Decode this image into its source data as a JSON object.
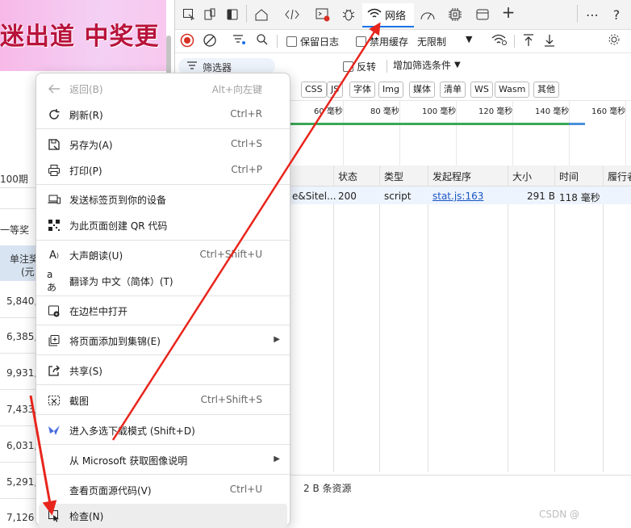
{
  "webpage": {
    "banner_text": "迷出道 中奖更",
    "period": "100期",
    "prize_label": "一等奖",
    "column_header_line1": "单注奖",
    "column_header_line2": "(元",
    "amounts": [
      "5,840,",
      "6,385,",
      "9,931,",
      "7,433,",
      "6,031,",
      "5,291,",
      "7,126"
    ]
  },
  "devtools": {
    "tabs": {
      "network_label": "网络"
    },
    "toolbar": {
      "preserve_log": "保留日志",
      "disable_cache": "禁用缓存",
      "throttle": "无限制"
    },
    "filter": {
      "placeholder": "筛选器",
      "invert": "反转",
      "more_filters": "增加筛选条件"
    },
    "type_chips": [
      "CSS",
      "JS",
      "字体",
      "Img",
      "媒体",
      "清单",
      "WS",
      "Wasm",
      "其他"
    ],
    "timeline_ticks": [
      "60 毫秒",
      "80 毫秒",
      "100 毫秒",
      "120 毫秒",
      "140 毫秒",
      "160 毫秒"
    ],
    "table": {
      "headers": [
        "状态",
        "类型",
        "发起程序",
        "大小",
        "时间",
        "履行者"
      ],
      "rows": [
        {
          "name": "e&Sitel...",
          "status": "200",
          "type": "script",
          "initiator": "stat.js:163",
          "size": "291 B",
          "time": "118 毫秒"
        }
      ]
    },
    "status_summary": "2 B 条资源"
  },
  "context_menu": {
    "items": [
      {
        "label": "返回(B)",
        "shortcut": "Alt+向左键",
        "icon": "back-arrow-icon",
        "disabled": true
      },
      {
        "label": "刷新(R)",
        "shortcut": "Ctrl+R",
        "icon": "refresh-icon"
      },
      {
        "label": "另存为(A)",
        "shortcut": "Ctrl+S",
        "icon": "save-as-icon"
      },
      {
        "label": "打印(P)",
        "shortcut": "Ctrl+P",
        "icon": "printer-icon"
      },
      {
        "label": "发送标签页到你的设备",
        "shortcut": "",
        "icon": "send-to-device-icon"
      },
      {
        "label": "为此页面创建 QR 代码",
        "shortcut": "",
        "icon": "qr-code-icon"
      },
      {
        "label": "大声朗读(U)",
        "shortcut": "Ctrl+Shift+U",
        "icon": "read-aloud-icon"
      },
      {
        "label": "翻译为 中文（简体）(T)",
        "shortcut": "",
        "icon": "translate-icon"
      },
      {
        "label": "在边栏中打开",
        "shortcut": "",
        "icon": "sidebar-icon"
      },
      {
        "label": "将页面添加到集锦(E)",
        "shortcut": "",
        "icon": "collections-icon",
        "submenu": true
      },
      {
        "label": "共享(S)",
        "shortcut": "",
        "icon": "share-icon"
      },
      {
        "label": "截图",
        "shortcut": "Ctrl+Shift+S",
        "icon": "screenshot-icon"
      },
      {
        "label": "进入多选下载模式 (Shift+D)",
        "shortcut": "",
        "icon": "download-mode-icon"
      },
      {
        "label": "从 Microsoft 获取图像说明",
        "shortcut": "",
        "icon": "",
        "submenu": true
      },
      {
        "label": "查看页面源代码(V)",
        "shortcut": "Ctrl+U",
        "icon": ""
      },
      {
        "label": "检查(N)",
        "shortcut": "",
        "icon": "inspect-icon",
        "highlighted": true
      }
    ]
  },
  "watermark": "CSDN @",
  "colors": {
    "accent_blue": "#1a73e8",
    "record_red": "#d93025",
    "annotation_red": "#e8251c",
    "timeline_green": "#3aa757"
  }
}
